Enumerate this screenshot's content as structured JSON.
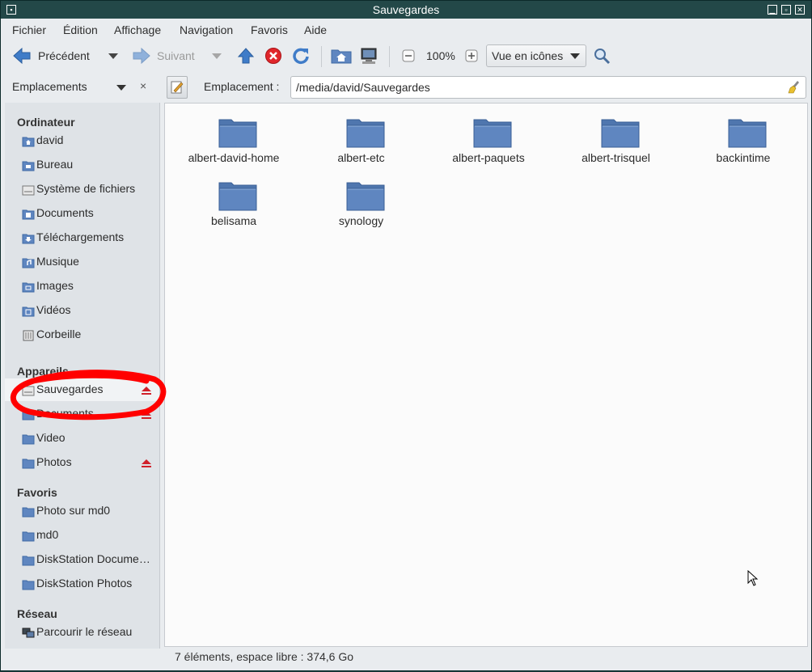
{
  "window": {
    "title": "Sauvegardes"
  },
  "menu": [
    "Fichier",
    "Édition",
    "Affichage",
    "Navigation",
    "Favoris",
    "Aide"
  ],
  "toolbar": {
    "back_label": "Précédent",
    "forward_label": "Suivant",
    "zoom_level": "100%",
    "view_mode": "Vue en icônes"
  },
  "location": {
    "panel_label": "Emplacements",
    "close_glyph": "×",
    "label": "Emplacement :",
    "path": "/media/david/Sauvegardes"
  },
  "sidebar": {
    "sections": [
      {
        "title": "Ordinateur",
        "items": [
          {
            "label": "david",
            "icon": "home-folder-icon"
          },
          {
            "label": "Bureau",
            "icon": "desktop-folder-icon"
          },
          {
            "label": "Système de fichiers",
            "icon": "drive-icon"
          },
          {
            "label": "Documents",
            "icon": "documents-folder-icon"
          },
          {
            "label": "Téléchargements",
            "icon": "downloads-folder-icon"
          },
          {
            "label": "Musique",
            "icon": "music-folder-icon"
          },
          {
            "label": "Images",
            "icon": "pictures-folder-icon"
          },
          {
            "label": "Vidéos",
            "icon": "videos-folder-icon"
          },
          {
            "label": "Corbeille",
            "icon": "trash-icon"
          }
        ]
      },
      {
        "title": "Appareils",
        "items": [
          {
            "label": "Sauvegardes",
            "icon": "drive-icon",
            "eject": true,
            "selected": true
          },
          {
            "label": "Documents",
            "icon": "folder-icon",
            "eject": true
          },
          {
            "label": "Video",
            "icon": "folder-icon"
          },
          {
            "label": "Photos",
            "icon": "folder-icon",
            "eject": true
          }
        ]
      },
      {
        "title": "Favoris",
        "items": [
          {
            "label": "Photo sur md0",
            "icon": "folder-icon"
          },
          {
            "label": "md0",
            "icon": "folder-icon"
          },
          {
            "label": "DiskStation Docume…",
            "icon": "folder-icon"
          },
          {
            "label": "DiskStation Photos",
            "icon": "folder-icon"
          }
        ]
      },
      {
        "title": "Réseau",
        "items": [
          {
            "label": "Parcourir le réseau",
            "icon": "network-icon"
          }
        ]
      }
    ]
  },
  "folders": [
    "albert-david-home",
    "albert-etc",
    "albert-paquets",
    "albert-trisquel",
    "backintime",
    "belisama",
    "synology"
  ],
  "status": "7 éléments, espace libre : 374,6 Go",
  "colors": {
    "titlebar": "#234848",
    "folder": "#5f86c0",
    "annotation": "#ff0000",
    "eject": "#d0202a"
  }
}
